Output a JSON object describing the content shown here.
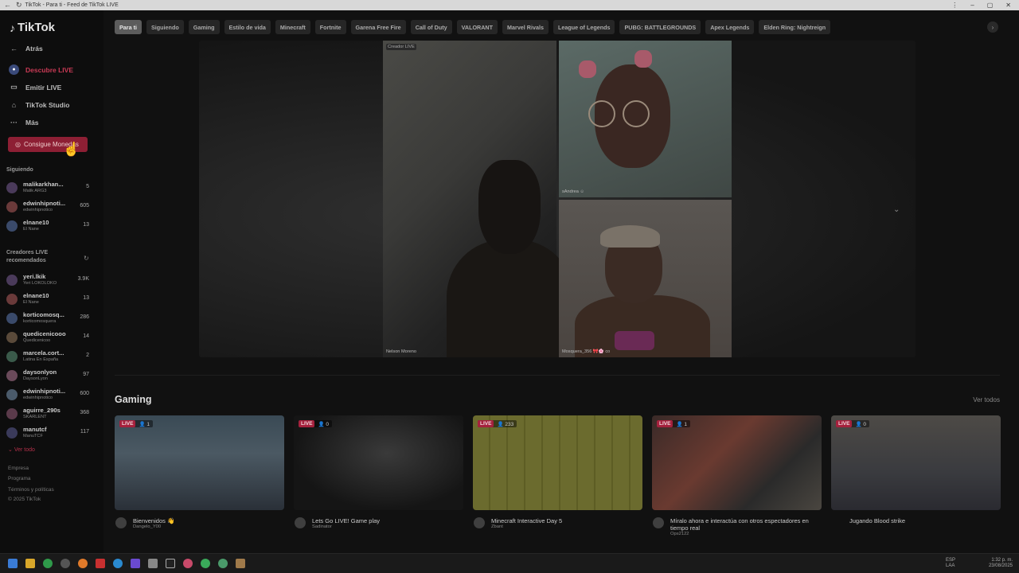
{
  "browser": {
    "title": "TikTok - Para ti - Feed de TikTok LIVE"
  },
  "sidebar": {
    "logo": "TikTok",
    "nav": [
      {
        "label": "Atrás",
        "icon": "back-arrow-icon"
      },
      {
        "label": "Descubre LIVE",
        "icon": "live-discover-icon",
        "accent": true
      },
      {
        "label": "Emitir LIVE",
        "icon": "camera-icon"
      },
      {
        "label": "TikTok Studio",
        "icon": "house-icon"
      },
      {
        "label": "Más",
        "icon": "ellipsis-icon"
      }
    ],
    "cta": "Consigue Monedas",
    "following_title": "Siguiendo",
    "following": [
      {
        "name": "malikarkhan...",
        "handle": "Malik ARG3",
        "count": "5"
      },
      {
        "name": "edwinhipnoti...",
        "handle": "edwinhipnotico",
        "count": "605"
      },
      {
        "name": "elnane10",
        "handle": "El Nane",
        "count": "13"
      }
    ],
    "recommended_title": "Creadores LIVE recomendados",
    "recommended": [
      {
        "name": "yeri.lkik",
        "handle": "Yeri LOKOLOKO",
        "count": "3.9K"
      },
      {
        "name": "elnane10",
        "handle": "El Nane",
        "count": "13"
      },
      {
        "name": "korticomosq...",
        "handle": "korticomosquera",
        "count": "286"
      },
      {
        "name": "quedicenicooo",
        "handle": "Quedicenicoo",
        "count": "14"
      },
      {
        "name": "marcela.cort...",
        "handle": "Latina En España",
        "count": "2"
      },
      {
        "name": "daysonlyon",
        "handle": "DaysonLyon",
        "count": "97"
      },
      {
        "name": "edwinhipnoti...",
        "handle": "edwinhipnotico",
        "count": "600"
      },
      {
        "name": "aguirre_290s",
        "handle": "SKARLENT",
        "count": "368"
      },
      {
        "name": "manutcf",
        "handle": "ManuTCF",
        "count": "117"
      }
    ],
    "see_all": "Ver todo",
    "footer": [
      "Empresa",
      "Programa",
      "Términos y políticas",
      "© 2025 TikTok"
    ]
  },
  "chips": [
    "Para ti",
    "Siguiendo",
    "Gaming",
    "Estilo de vida",
    "Minecraft",
    "Fortnite",
    "Garena Free Fire",
    "Call of Duty",
    "VALORANT",
    "Marvel Rivals",
    "League of Legends",
    "PUBG: BATTLEGROUNDS",
    "Apex Legends",
    "Elden Ring: Nightreign"
  ],
  "stage": {
    "tag": "Creador LIVE",
    "tiles": [
      {
        "name": "Nelson Moreno"
      },
      {
        "name": "sAndrea ☺"
      },
      {
        "name": "Mosquera_356 🎀🌸 co"
      }
    ]
  },
  "gaming": {
    "title": "Gaming",
    "see_all": "Ver todos",
    "cards": [
      {
        "live": "LIVE",
        "viewers": "1",
        "title": "Bienvenidos 👋",
        "user": "Dangelo_Y00"
      },
      {
        "live": "LIVE",
        "viewers": "0",
        "title": "Lets Go LIVE! Game play",
        "user": "Sadinator"
      },
      {
        "live": "LIVE",
        "viewers": "233",
        "title": "Minecraft Interactive Day 5",
        "user": "Zbant"
      },
      {
        "live": "LIVE",
        "viewers": "1",
        "title": "Míralo ahora e interactúa con otros espectadores en tiempo real",
        "user": "Ops2122"
      },
      {
        "live": "LIVE",
        "viewers": "0",
        "title": "Jugando Blood strike",
        "user": ""
      }
    ]
  },
  "taskbar": {
    "lang": "ESP",
    "layout": "LAA",
    "time": "1:32 p. m.",
    "date": "23/08/2025"
  }
}
